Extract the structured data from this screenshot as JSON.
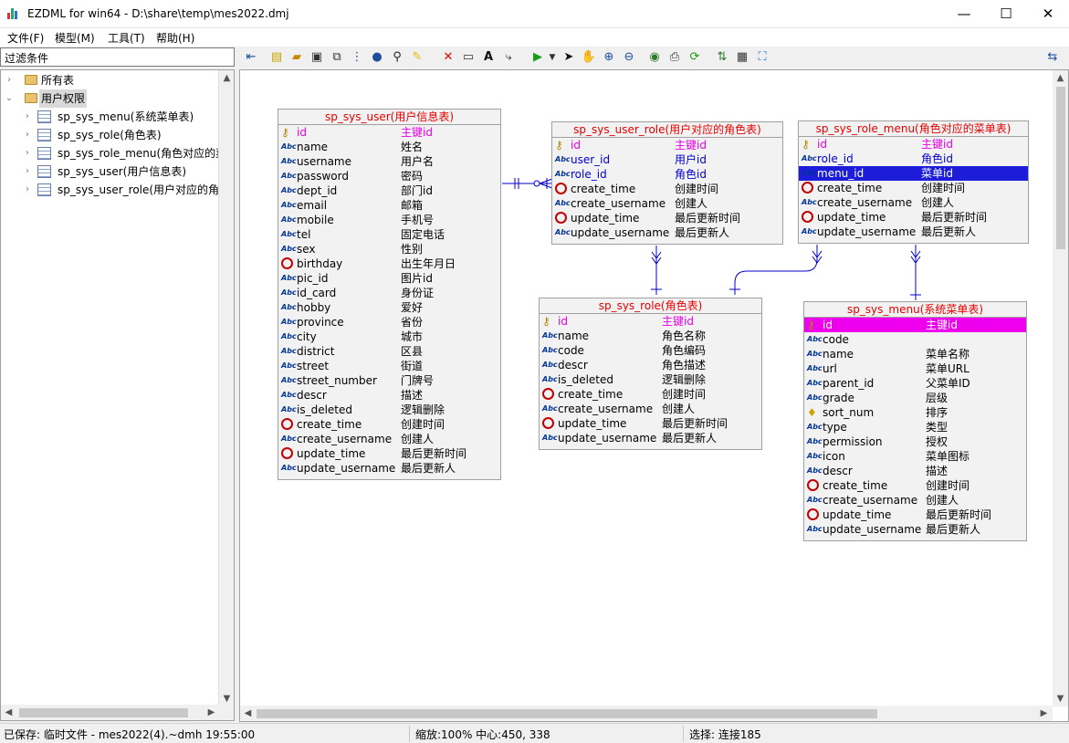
{
  "window": {
    "title": "EZDML for win64 - D:\\share\\temp\\mes2022.dmj",
    "minimize": "—",
    "maximize": "☐",
    "close": "✕"
  },
  "menu": [
    "文件(F)",
    "模型(M)",
    "工具(T)",
    "帮助(H)"
  ],
  "filter": {
    "label": "过滤条件"
  },
  "tree": {
    "root1": "所有表",
    "root2": "用户权限",
    "items": [
      "sp_sys_menu(系统菜单表)",
      "sp_sys_role(角色表)",
      "sp_sys_role_menu(角色对应的菜",
      "sp_sys_user(用户信息表)",
      "sp_sys_user_role(用户对应的角色"
    ]
  },
  "entities": {
    "user": {
      "title": "sp_sys_user(用户信息表)",
      "fields": [
        [
          "id",
          "主键id",
          "pk"
        ],
        [
          "name",
          "姓名",
          "str"
        ],
        [
          "username",
          "用户名",
          "str"
        ],
        [
          "password",
          "密码",
          "str"
        ],
        [
          "dept_id",
          "部门id",
          "str"
        ],
        [
          "email",
          "邮箱",
          "str"
        ],
        [
          "mobile",
          "手机号",
          "str"
        ],
        [
          "tel",
          "固定电话",
          "str"
        ],
        [
          "sex",
          "性别",
          "str"
        ],
        [
          "birthday",
          "出生年月日",
          "clk"
        ],
        [
          "pic_id",
          "图片id",
          "str"
        ],
        [
          "id_card",
          "身份证",
          "str"
        ],
        [
          "hobby",
          "爱好",
          "str"
        ],
        [
          "province",
          "省份",
          "str"
        ],
        [
          "city",
          "城市",
          "str"
        ],
        [
          "district",
          "区县",
          "str"
        ],
        [
          "street",
          "街道",
          "str"
        ],
        [
          "street_number",
          "门牌号",
          "str"
        ],
        [
          "descr",
          "描述",
          "str"
        ],
        [
          "is_deleted",
          "逻辑删除",
          "str"
        ],
        [
          "create_time",
          "创建时间",
          "clk"
        ],
        [
          "create_username",
          "创建人",
          "str"
        ],
        [
          "update_time",
          "最后更新时间",
          "clk"
        ],
        [
          "update_username",
          "最后更新人",
          "str"
        ]
      ]
    },
    "user_role": {
      "title": "sp_sys_user_role(用户对应的角色表)",
      "fields": [
        [
          "id",
          "主键id",
          "pk"
        ],
        [
          "user_id",
          "用户id",
          "fk"
        ],
        [
          "role_id",
          "角色id",
          "fk"
        ],
        [
          "create_time",
          "创建时间",
          "clk"
        ],
        [
          "create_username",
          "创建人",
          "str"
        ],
        [
          "update_time",
          "最后更新时间",
          "clk"
        ],
        [
          "update_username",
          "最后更新人",
          "str"
        ]
      ]
    },
    "role_menu": {
      "title": "sp_sys_role_menu(角色对应的菜单表)",
      "fields": [
        [
          "id",
          "主键id",
          "pk"
        ],
        [
          "role_id",
          "角色id",
          "fk"
        ],
        [
          "menu_id",
          "菜单id",
          "hl"
        ],
        [
          "create_time",
          "创建时间",
          "clk"
        ],
        [
          "create_username",
          "创建人",
          "str"
        ],
        [
          "update_time",
          "最后更新时间",
          "clk"
        ],
        [
          "update_username",
          "最后更新人",
          "str"
        ]
      ]
    },
    "role": {
      "title": "sp_sys_role(角色表)",
      "fields": [
        [
          "id",
          "主键id",
          "pk"
        ],
        [
          "name",
          "角色名称",
          "str"
        ],
        [
          "code",
          "角色编码",
          "str"
        ],
        [
          "descr",
          "角色描述",
          "str"
        ],
        [
          "is_deleted",
          "逻辑删除",
          "str"
        ],
        [
          "create_time",
          "创建时间",
          "clk"
        ],
        [
          "create_username",
          "创建人",
          "str"
        ],
        [
          "update_time",
          "最后更新时间",
          "clk"
        ],
        [
          "update_username",
          "最后更新人",
          "str"
        ]
      ]
    },
    "menu": {
      "title": "sp_sys_menu(系统菜单表)",
      "fields": [
        [
          "id",
          "主键id",
          "hlm"
        ],
        [
          "code",
          "",
          "str"
        ],
        [
          "name",
          "菜单名称",
          "str"
        ],
        [
          "url",
          "菜单URL",
          "str"
        ],
        [
          "parent_id",
          "父菜单ID",
          "str"
        ],
        [
          "grade",
          "层级",
          "str"
        ],
        [
          "sort_num",
          "排序",
          "bulb"
        ],
        [
          "type",
          "类型",
          "str"
        ],
        [
          "permission",
          "授权",
          "str"
        ],
        [
          "icon",
          "菜单图标",
          "str"
        ],
        [
          "descr",
          "描述",
          "str"
        ],
        [
          "create_time",
          "创建时间",
          "clk"
        ],
        [
          "create_username",
          "创建人",
          "str"
        ],
        [
          "update_time",
          "最后更新时间",
          "clk"
        ],
        [
          "update_username",
          "最后更新人",
          "str"
        ]
      ]
    }
  },
  "status": {
    "saved": "已保存: 临时文件 - mes2022(4).~dmh 19:55:00",
    "zoom": "缩放:100% 中心:450, 338",
    "selection": "选择: 连接185"
  }
}
